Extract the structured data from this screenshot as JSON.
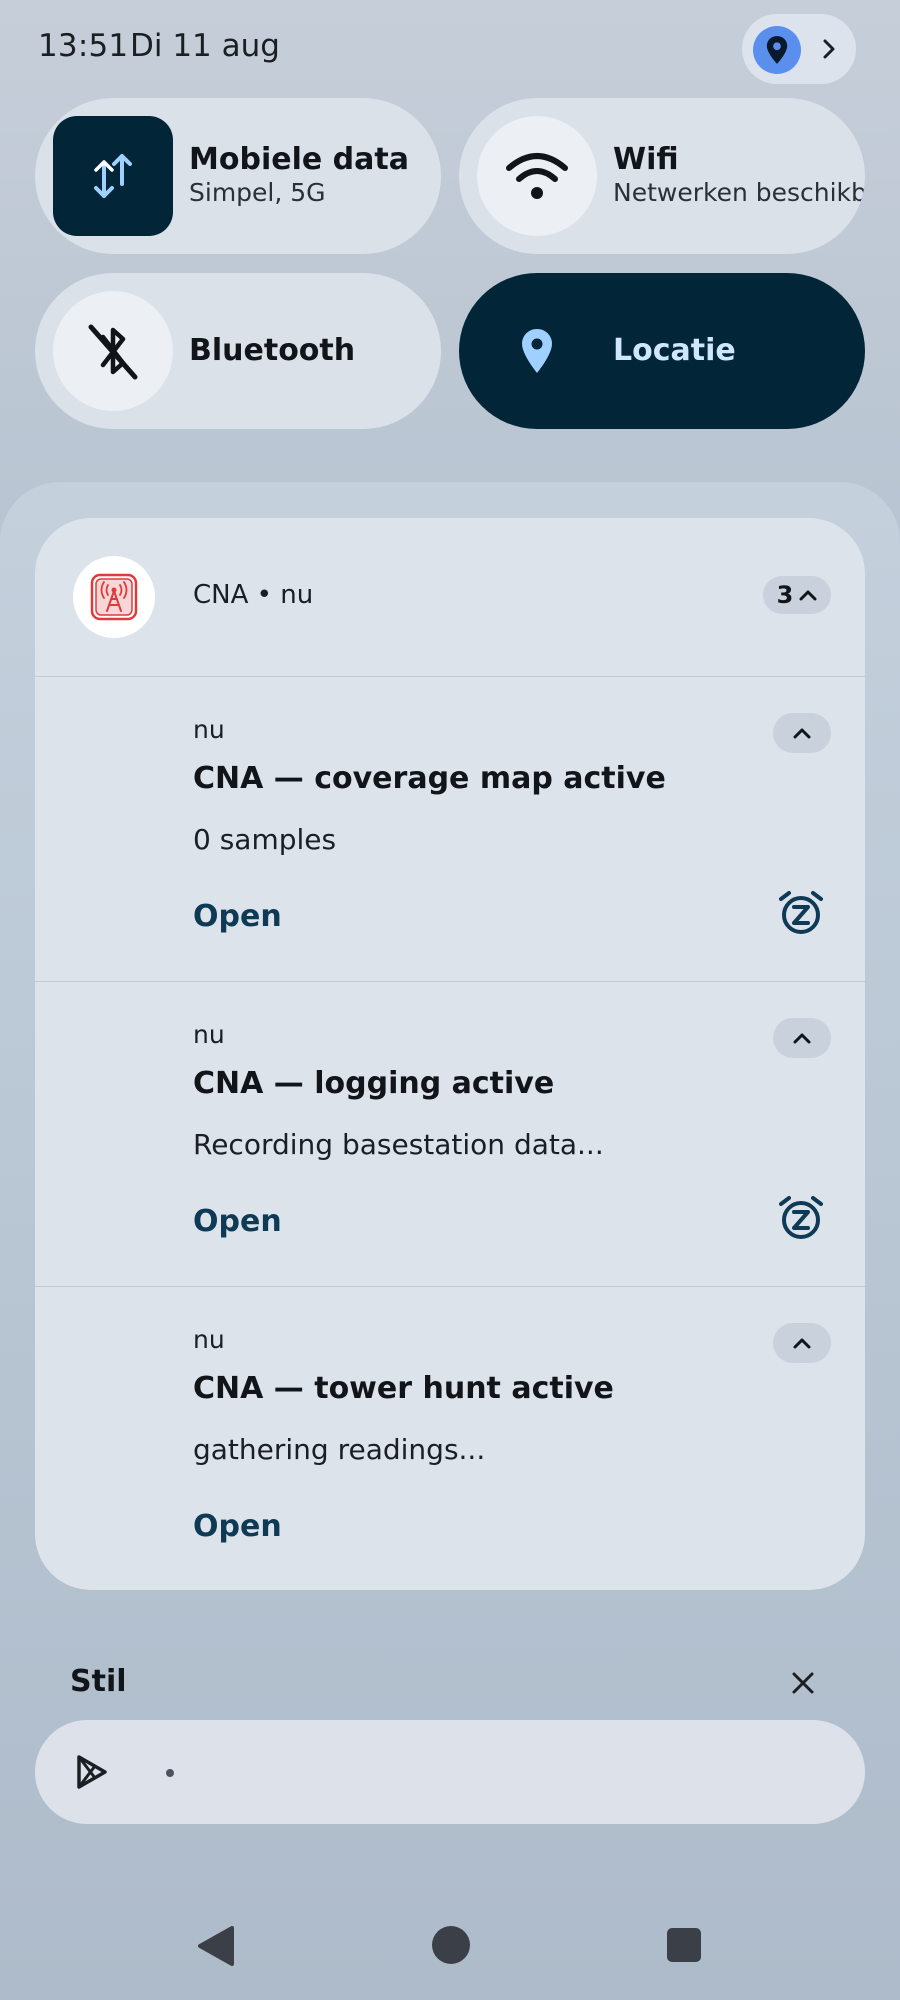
{
  "status": {
    "time": "13:51",
    "date": "Di 11 aug",
    "location_icon": "location-pin-icon",
    "expand_icon": "chevron-right-icon"
  },
  "tiles": [
    {
      "title": "Mobiele data",
      "subtitle": "Simpel, 5G",
      "icon": "mobile-data-arrows-icon",
      "state": "on"
    },
    {
      "title": "Wifi",
      "subtitle": "Netwerken beschikbaar",
      "icon": "wifi-icon",
      "state": "off"
    },
    {
      "title": "Bluetooth",
      "subtitle": "",
      "icon": "bluetooth-off-icon",
      "state": "off"
    },
    {
      "title": "Locatie",
      "subtitle": "",
      "icon": "location-pin-icon",
      "state": "on"
    }
  ],
  "notification_group": {
    "app_name": "CNA",
    "header_text": "CNA • nu",
    "count": "3",
    "notifications": [
      {
        "time": "nu",
        "title": "CNA — coverage map active",
        "text": "0 samples",
        "action": "Open",
        "has_snooze": true
      },
      {
        "time": "nu",
        "title": "CNA — logging active",
        "text": "Recording basestation data...",
        "action": "Open",
        "has_snooze": true
      },
      {
        "time": "nu",
        "title": "CNA — tower hunt active",
        "text": "gathering readings...",
        "action": "Open",
        "has_snooze": false
      }
    ]
  },
  "silent_section": {
    "label": "Stil",
    "app_icon": "play-store-icon"
  },
  "navigation": {
    "back_icon": "back-triangle-icon",
    "home_icon": "home-circle-icon",
    "recents_icon": "recents-square-icon"
  },
  "colors": {
    "tile_active": "#022538",
    "tile_inactive": "#dbe1e9",
    "accent_icon": "#9fd0ff",
    "action_text": "#0e3a55",
    "app_icon_red": "#e03a3a"
  }
}
